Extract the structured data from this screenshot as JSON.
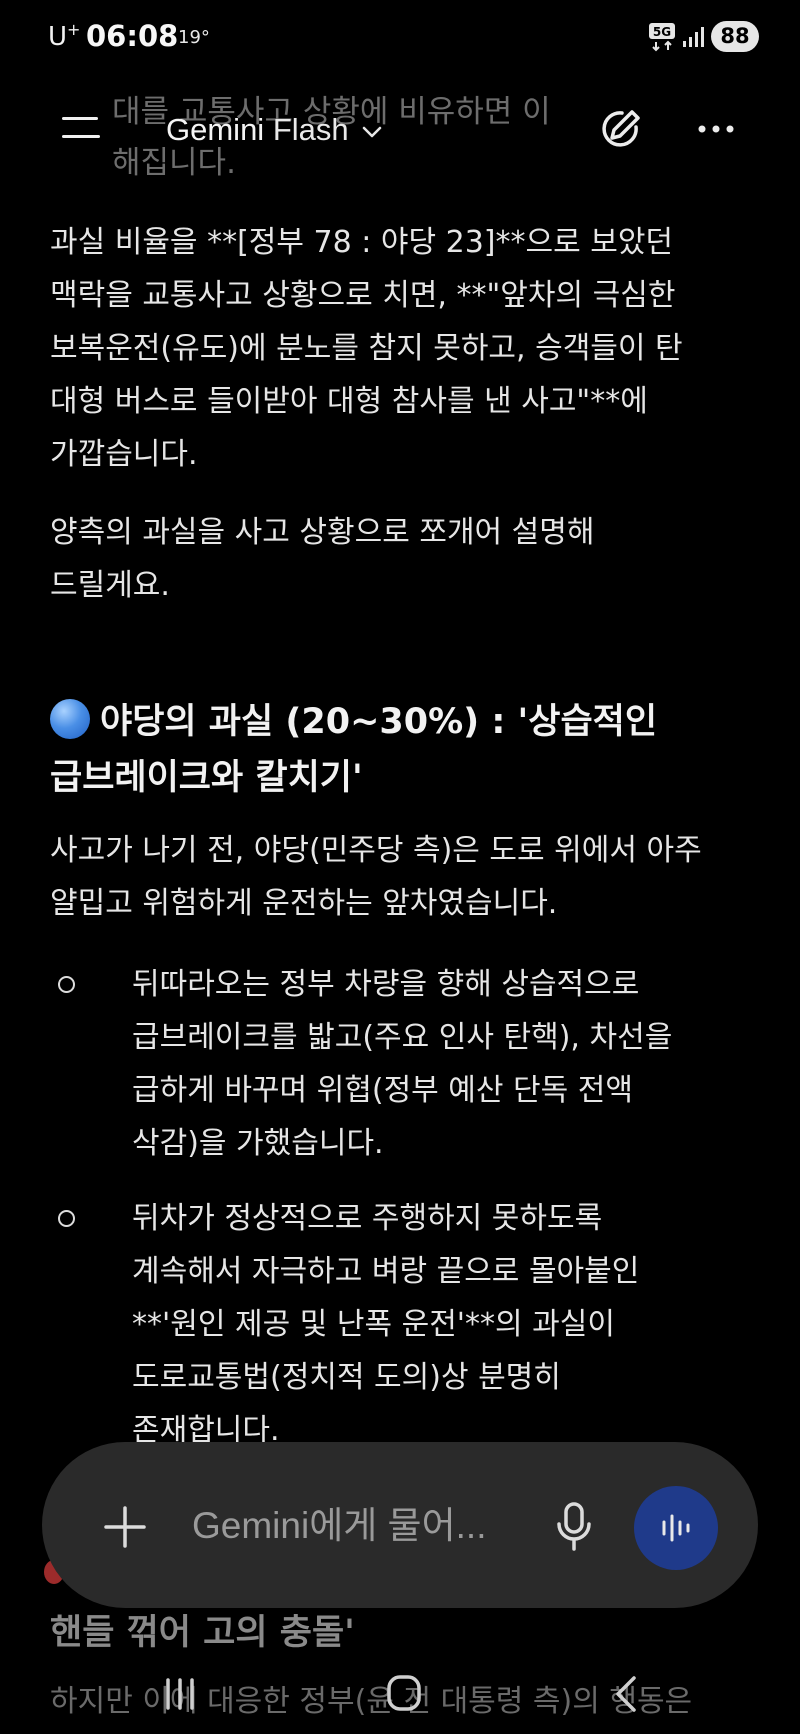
{
  "status_bar": {
    "carrier": "U",
    "carrier_plus": "+",
    "time": "06:08",
    "temperature": "19°",
    "network": "5G",
    "battery": "88"
  },
  "app_bar": {
    "brand": "Gemini",
    "model": "Flash",
    "icons": [
      "menu-icon",
      "chevron-down-icon",
      "edit-icon",
      "more-icon"
    ]
  },
  "content": {
    "ghost_lines": [
      "대를 교통사고 상황에 비유하면 이",
      "해집니다."
    ],
    "paragraph1": [
      "과실 비율을 **[정부 78 : 야당 23]**으로 보았던",
      "맥락을 교통사고 상황으로 치면, **\"앞차의 극심한",
      "보복운전(유도)에 분노를 참지 못하고, 승객들이 탄",
      "대형 버스로 들이받아 대형 참사를 낸 사고\"**에",
      "가깝습니다."
    ],
    "paragraph2": [
      "양측의 과실을 사고 상황으로 쪼개어 설명해",
      "드릴게요."
    ],
    "section1_title": [
      "야당의 과실 (20~30%) : '상습적인",
      "급브레이크와 칼치기'"
    ],
    "section1_intro": [
      "사고가 나기 전, 야당(민주당 측)은 도로 위에서 아주",
      "얄밉고 위험하게 운전하는 앞차였습니다."
    ],
    "bullets": [
      [
        "뒤따라오는 정부 차량을 향해 상습적으로",
        "급브레이크를 밟고(주요 인사 탄핵), 차선을",
        "급하게 바꾸며 위협(정부 예산 단독 전액",
        "삭감)을 가했습니다."
      ],
      [
        "뒤차가 정상적으로 주행하지 못하도록",
        "계속해서 자극하고 벼랑 끝으로 몰아붙인",
        "**'원인 제공 및 난폭 운전'**의 과실이",
        "도로교통법(정치적 도의)상 분명히",
        "존재합니다."
      ]
    ],
    "faded_title": "핸들 꺾어 고의 충돌'",
    "faded_line": "하지만 이에 대응한 정부(윤 전 대통령 측)의 행동은"
  },
  "input": {
    "placeholder": "Gemini에게 물어...",
    "icons": [
      "add-icon",
      "mic-icon",
      "live-icon"
    ]
  },
  "colors": {
    "background": "#000000",
    "text": "#e6e6e6",
    "input_bg": "#2a2a2a",
    "live_button": "#1f3a8a"
  }
}
